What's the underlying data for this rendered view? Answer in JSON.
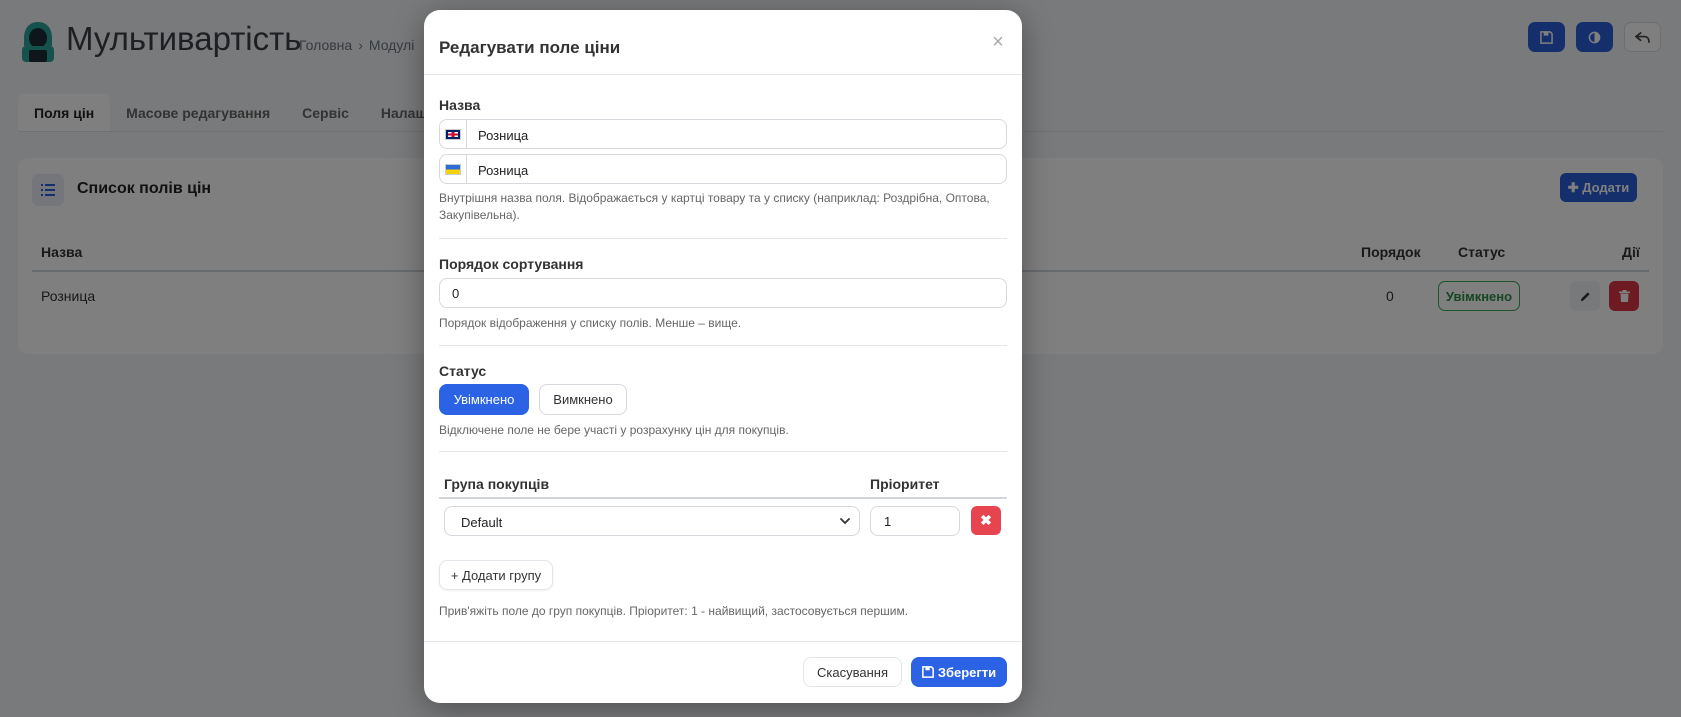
{
  "header": {
    "title": "Мультивартість",
    "breadcrumb": [
      "Головна",
      "Модулі"
    ],
    "buttons": [
      "save-icon",
      "contrast-icon",
      "back-icon"
    ]
  },
  "tabs": [
    {
      "label": "Поля цін",
      "active": true
    },
    {
      "label": "Масове редагування",
      "active": false
    },
    {
      "label": "Сервіс",
      "active": false
    },
    {
      "label": "Налашту",
      "active": false
    }
  ],
  "list_card": {
    "title": "Список полів цін",
    "add_label": "Додати",
    "columns": {
      "name": "Назва",
      "order": "Порядок",
      "status": "Статус",
      "actions": "Дії"
    },
    "rows": [
      {
        "name": "Розница",
        "order": "0",
        "status": "Увімкнено"
      }
    ]
  },
  "modal": {
    "title": "Редагувати поле ціни",
    "close_label": "×",
    "name_section": {
      "label": "Назва",
      "values": [
        {
          "lang": "gb-flag",
          "value": "Розница"
        },
        {
          "lang": "ua-flag",
          "value": "Розница"
        }
      ],
      "help": "Внутрішня назва поля. Відображається у картці товару та у списку (наприклад: Роздрібна, Оптова, Закупівельна)."
    },
    "sort_section": {
      "label": "Порядок сортування",
      "value": "0",
      "help": "Порядок відображення у списку полів. Менше – вище."
    },
    "status_section": {
      "label": "Статус",
      "on_label": "Увімкнено",
      "off_label": "Вимкнено",
      "selected": "Увімкнено",
      "help": "Відключене поле не бере участі у розрахунку цін для покупців."
    },
    "groups_section": {
      "col_group": "Група покупців",
      "col_priority": "Пріоритет",
      "rows": [
        {
          "group": "Default",
          "priority": "1"
        }
      ],
      "add_label": "+ Додати групу",
      "help": "Прив'яжіть поле до груп покупців. Пріоритет: 1 - найвищий, застосовується першим."
    },
    "footer": {
      "cancel_label": "Скасування",
      "save_label": "Зберегти"
    }
  },
  "colors": {
    "primary": "#2b63e4",
    "danger": "#e6444f",
    "success": "#2c8d46"
  }
}
